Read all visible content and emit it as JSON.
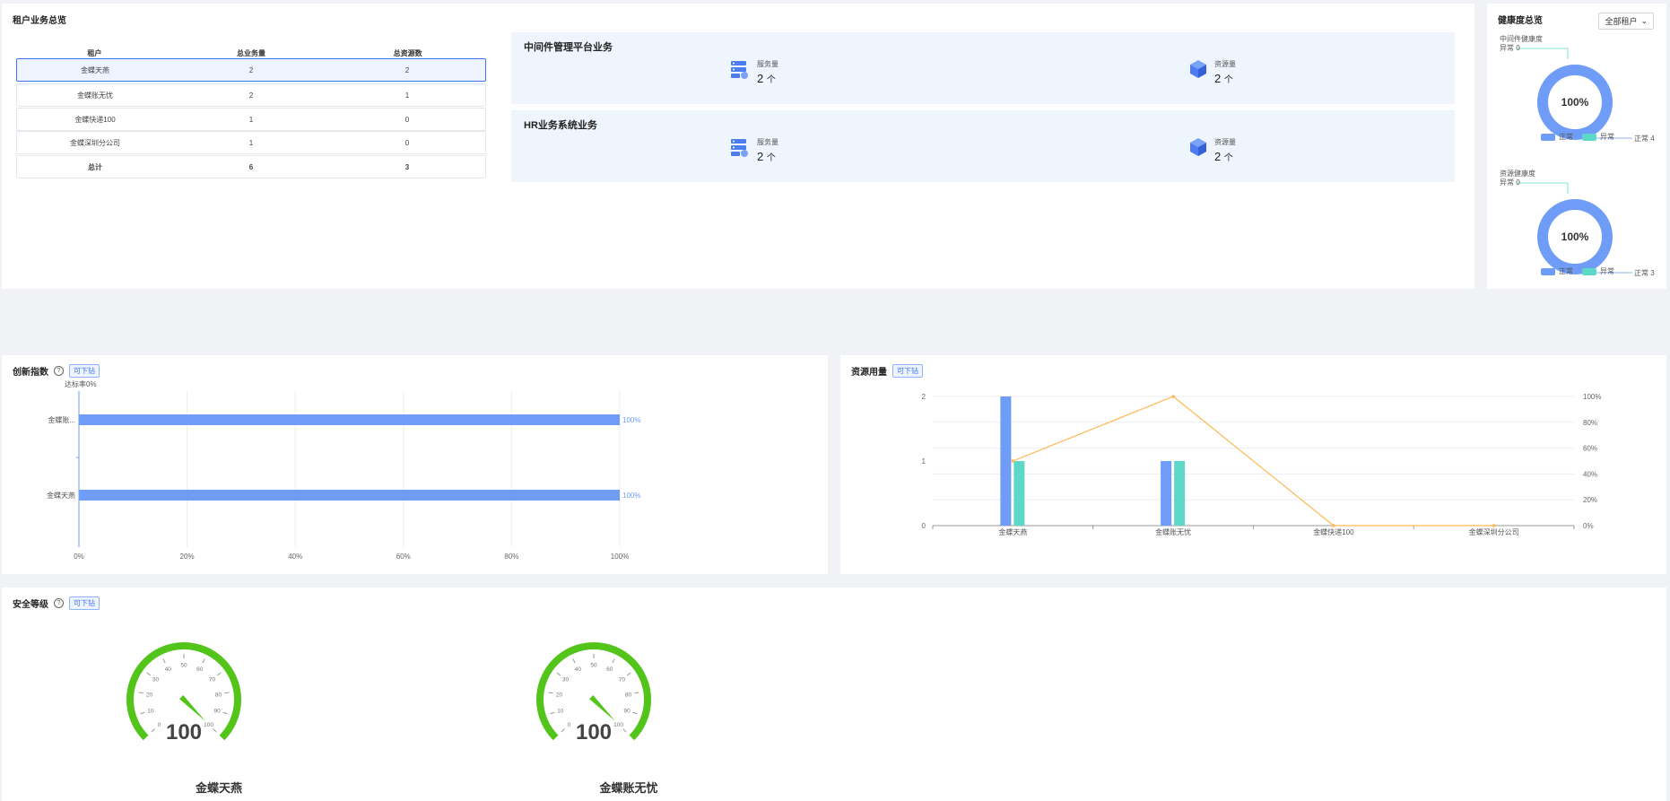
{
  "tenant_panel": {
    "title": "租户业务总览",
    "headers": [
      "租户",
      "总业务量",
      "总资源数"
    ],
    "rows": [
      [
        "金蝶天燕",
        "2",
        "2"
      ],
      [
        "金蝶账无忧",
        "2",
        "1"
      ],
      [
        "金蝶快递100",
        "1",
        "0"
      ],
      [
        "金蝶深圳分公司",
        "1",
        "0"
      ]
    ],
    "total": [
      "总计",
      "6",
      "3"
    ]
  },
  "business": [
    {
      "title": "中间件管理平台业务",
      "service_label": "服务量",
      "service_value": "2",
      "resource_label": "资源量",
      "resource_value": "2",
      "unit": "个"
    },
    {
      "title": "HR业务系统业务",
      "service_label": "服务量",
      "service_value": "2",
      "resource_label": "资源量",
      "resource_value": "2",
      "unit": "个"
    }
  ],
  "health": {
    "title": "健康度总览",
    "select_value": "全部租户",
    "middleware": {
      "label": "中间件健康度",
      "abnormal": "异常 0",
      "normal": "正常 4",
      "percent": "100%",
      "legend": [
        "正常",
        "异常"
      ]
    },
    "resource": {
      "label": "资源健康度",
      "abnormal": "异常 0",
      "normal": "正常 3",
      "percent": "100%",
      "legend": [
        "正常",
        "异常"
      ]
    },
    "colors": {
      "normal": "#6e9cf7",
      "abnormal": "#5dd8c8"
    }
  },
  "innovation": {
    "title": "创新指数",
    "drill": "可下钻",
    "q": "?",
    "ylabel": "达标率0%",
    "ticks": [
      "0%",
      "20%",
      "40%",
      "60%",
      "80%",
      "100%"
    ]
  },
  "resource_usage": {
    "title": "资源用量",
    "drill": "可下钻",
    "left_ticks": [
      "0",
      "1",
      "2"
    ],
    "right_ticks": [
      "0%",
      "20%",
      "40%",
      "60%",
      "80%",
      "100%"
    ]
  },
  "security": {
    "title": "安全等级",
    "drill": "可下钻",
    "q": "?",
    "gauge_ticks": [
      "0",
      "10",
      "20",
      "30",
      "40",
      "50",
      "60",
      "70",
      "80",
      "90",
      "100"
    ],
    "gauges": [
      {
        "name": "金蝶天燕",
        "value": 100
      },
      {
        "name": "金蝶账无忧",
        "value": 100
      }
    ]
  },
  "chart_data": [
    {
      "type": "bar",
      "orientation": "horizontal",
      "title": "创新指数",
      "categories": [
        "金蝶天燕",
        "金蝶账..."
      ],
      "values": [
        100,
        100
      ],
      "value_labels": [
        "100%",
        "100%"
      ],
      "xlim": [
        0,
        100
      ],
      "grid": true,
      "color": "#6e9cf7"
    },
    {
      "type": "bar",
      "title": "资源用量",
      "categories": [
        "金蝶天燕",
        "金蝶账无忧",
        "金蝶快递100",
        "金蝶深圳分公司"
      ],
      "series": [
        {
          "values": [
            2,
            1,
            0,
            0
          ],
          "color": "#6e9cf7",
          "axis": "left"
        },
        {
          "values": [
            1,
            1,
            0,
            0
          ],
          "color": "#5dd8c8",
          "axis": "left"
        },
        {
          "type": "line",
          "values": [
            50,
            100,
            0,
            0
          ],
          "color": "#ffb957",
          "axis": "right"
        }
      ],
      "ylim": [
        0,
        2
      ],
      "y2lim": [
        0,
        100
      ],
      "grid": true
    }
  ]
}
